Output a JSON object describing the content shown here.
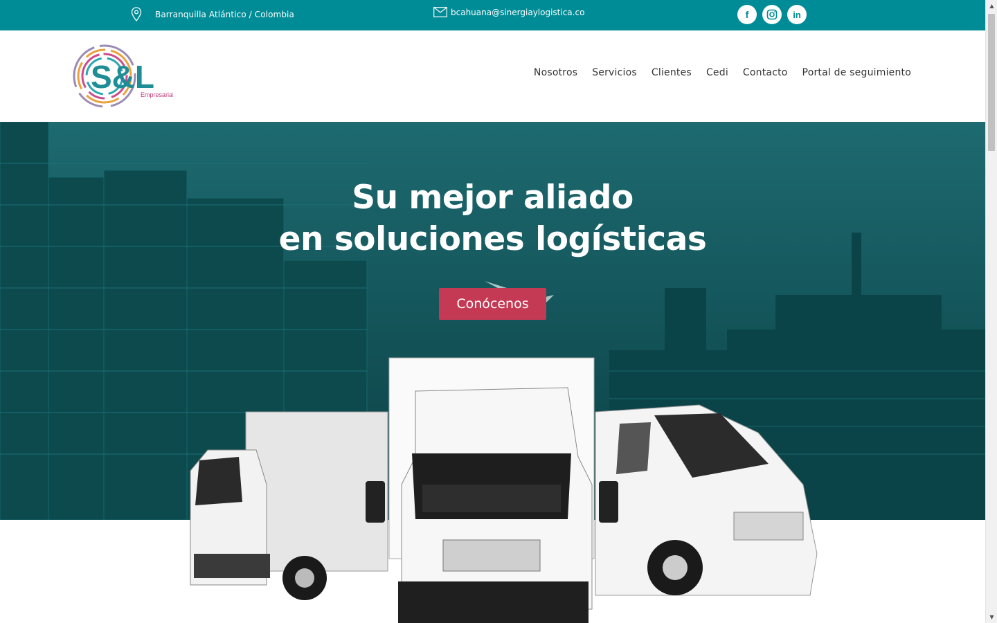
{
  "topbar": {
    "location": "Barranquilla Atlántico / Colombia",
    "email": "bcahuana@sinergiaylogistica.co",
    "social": [
      {
        "icon": "facebook-icon",
        "glyph": "f"
      },
      {
        "icon": "instagram-icon",
        "glyph": "◎"
      },
      {
        "icon": "linkedin-icon",
        "glyph": "in"
      }
    ]
  },
  "logo": {
    "mark": "S&L",
    "sub": "Empresarial"
  },
  "nav": {
    "items": [
      "Nosotros",
      "Servicios",
      "Clientes",
      "Cedi",
      "Contacto",
      "Portal de seguimiento"
    ]
  },
  "hero": {
    "line1": "Su mejor aliado",
    "line2": "en soluciones logísticas",
    "cta": "Conócenos"
  },
  "colors": {
    "topbar": "#008c96",
    "cta": "#c43a55",
    "hero_tint": "#0d4f53"
  }
}
